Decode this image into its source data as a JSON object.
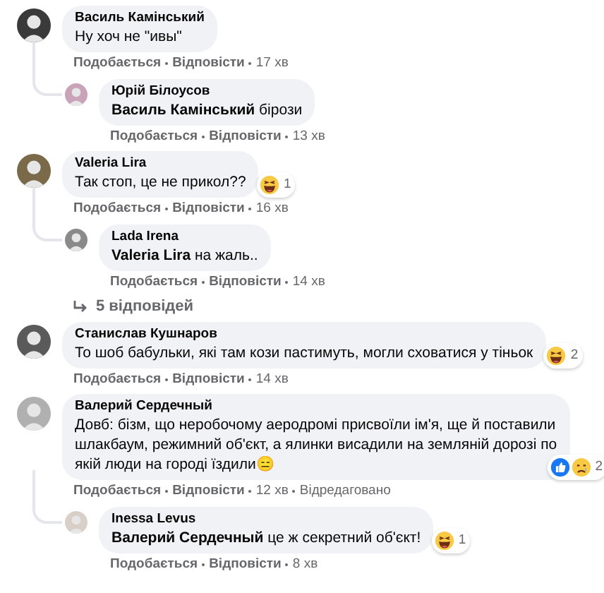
{
  "comments": [
    {
      "author": "Василь Камінський",
      "text": "Ну хоч не \"ивы\"",
      "meta": [
        {
          "kind": "link",
          "text": "Подобається"
        },
        {
          "kind": "link",
          "text": "Відповісти"
        },
        {
          "kind": "time",
          "text": "17 хв"
        }
      ],
      "children": [
        {
          "author": "Юрій Білоусов",
          "text": "**Василь Камінський** бiрози",
          "meta": [
            {
              "kind": "link",
              "text": "Подобається"
            },
            {
              "kind": "link",
              "text": "Відповісти"
            },
            {
              "kind": "time",
              "text": "13 хв"
            }
          ]
        }
      ]
    },
    {
      "author": "Valeria Lira",
      "text": "Так стоп, це не прикол??",
      "reactions": [
        {
          "kind": "haha"
        }
      ],
      "reaction_count": "1",
      "meta": [
        {
          "kind": "link",
          "text": "Подобається"
        },
        {
          "kind": "link",
          "text": "Відповісти"
        },
        {
          "kind": "time",
          "text": "16 хв"
        }
      ],
      "children": [
        {
          "author": "Lada Irena",
          "text": "**Valeria Lira** на жаль..",
          "meta": [
            {
              "kind": "link",
              "text": "Подобається"
            },
            {
              "kind": "link",
              "text": "Відповісти"
            },
            {
              "kind": "time",
              "text": "14 хв"
            }
          ]
        }
      ],
      "more_replies": "5 відповідей"
    },
    {
      "author": "Станислав Кушнаров",
      "text": "То шоб бабульки, які там кози пастимуть, могли сховатися у тіньок",
      "reactions": [
        {
          "kind": "haha"
        }
      ],
      "reaction_count": "2",
      "meta": [
        {
          "kind": "link",
          "text": "Подобається"
        },
        {
          "kind": "link",
          "text": "Відповісти"
        },
        {
          "kind": "time",
          "text": "14 хв"
        }
      ]
    },
    {
      "author": "Валерий Сердечный",
      "text": "Довб: бізм, що неробочому аеродромі присвоїли ім'я, ще й поставили шлакбаум, режимний об'єкт, а ялинки висадили на земляній дорозі по якій люди на городі їздили😑",
      "reactions": [
        {
          "kind": "like"
        },
        {
          "kind": "sad"
        }
      ],
      "reaction_count": "2",
      "meta": [
        {
          "kind": "link",
          "text": "Подобається"
        },
        {
          "kind": "link",
          "text": "Відповісти"
        },
        {
          "kind": "time",
          "text": "12 хв"
        },
        {
          "kind": "note",
          "text": "Відредаговано"
        }
      ],
      "children": [
        {
          "author": "Inessa Levus",
          "text": "**Валерий Сердечный** це ж секретний об'єкт!",
          "reactions": [
            {
              "kind": "haha"
            }
          ],
          "reaction_count": "1",
          "meta": [
            {
              "kind": "link",
              "text": "Подобається"
            },
            {
              "kind": "link",
              "text": "Відповісти"
            },
            {
              "kind": "time",
              "text": "8 хв"
            }
          ]
        }
      ]
    }
  ]
}
